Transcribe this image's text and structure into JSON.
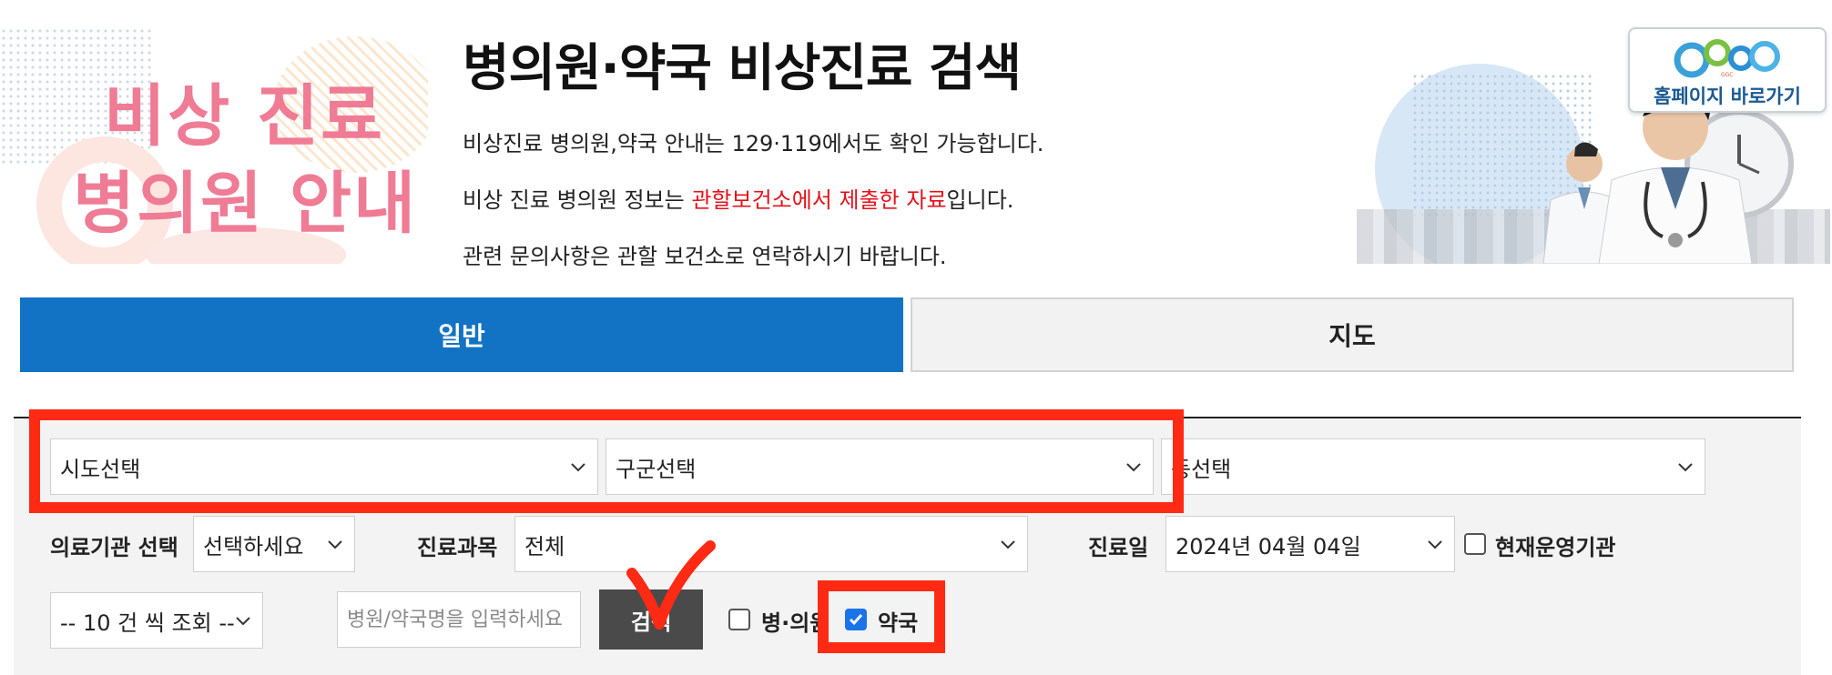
{
  "header": {
    "banner_line1": "비상 진료",
    "banner_line2": "병의원 안내",
    "title": "병의원·약국 비상진료 검색",
    "info1": "비상진료 병의원,약국 안내는 129·119에서도 확인 가능합니다.",
    "info2_pre": "비상 진료 병의원 정보는 ",
    "info2_red": "관할보건소에서 제출한 자료",
    "info2_post": "입니다.",
    "info3": "관련 문의사항은 관할 보건소로 연락하시기 바랍니다.",
    "homepage_button": "홈페이지 바로가기",
    "logo_text": "GGC"
  },
  "tabs": [
    {
      "label": "일반",
      "active": true
    },
    {
      "label": "지도",
      "active": false
    }
  ],
  "filters": {
    "sido": "시도선택",
    "gugun": "구군선택",
    "dong": "동선택",
    "institution_label": "의료기관 선택",
    "institution_value": "선택하세요",
    "department_label": "진료과목",
    "department_value": "전체",
    "date_label": "진료일",
    "date_value": "2024년 04월 04일",
    "operating_now": "현재운영기관",
    "operating_now_checked": false,
    "page_size": "-- 10 건 씩 조회 --",
    "search_placeholder": "병원/약국명을 입력하세요",
    "search_button": "검색",
    "hospital_checkbox": "병·의원",
    "hospital_checked": false,
    "pharmacy_checkbox": "약국",
    "pharmacy_checked": true
  },
  "colors": {
    "tab_active": "#1273c4",
    "annotation": "#ff2a14",
    "banner_pink": "#ef7b95",
    "highlight_red": "#e5111a"
  }
}
